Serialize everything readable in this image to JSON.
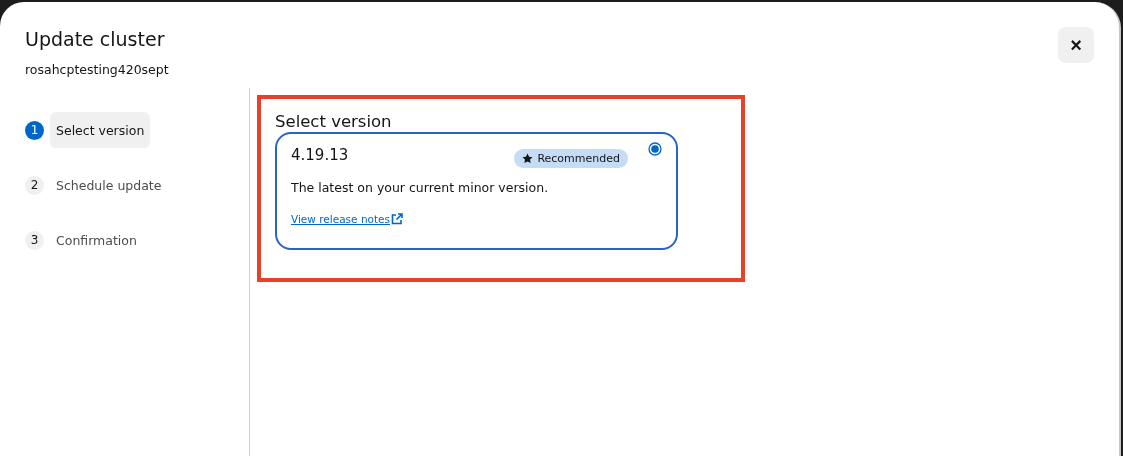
{
  "dialog": {
    "title": "Update cluster",
    "subtitle": "rosahcptesting420sept",
    "close_label": "×"
  },
  "steps": [
    {
      "number": "1",
      "label": "Select version",
      "selected": true
    },
    {
      "number": "2",
      "label": "Schedule update",
      "selected": false
    },
    {
      "number": "3",
      "label": "Confirmation",
      "selected": false
    }
  ],
  "content": {
    "highlighted": true,
    "heading": "Select version",
    "versions": [
      {
        "version": "4.19.13",
        "badge": "Recommended",
        "description": "The latest on your current minor version.",
        "link": "View release notes",
        "selected": true
      }
    ]
  }
}
